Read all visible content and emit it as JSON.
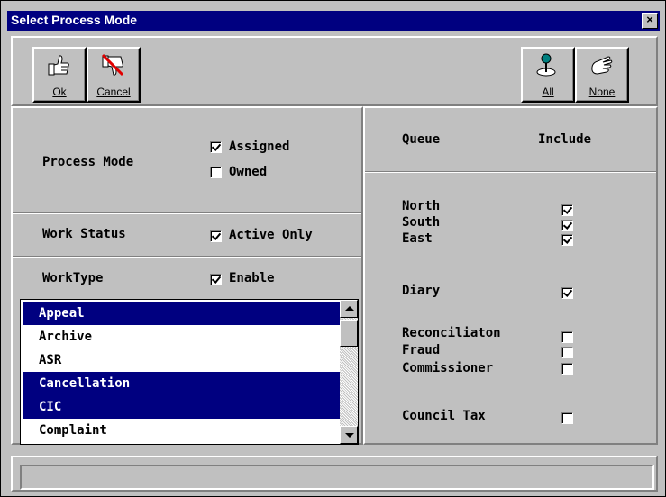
{
  "window": {
    "title": "Select Process Mode",
    "close_label": "×"
  },
  "toolbar": {
    "ok_label": "Ok",
    "cancel_label": "Cancel",
    "all_label": "All",
    "none_label": "None"
  },
  "process_mode": {
    "label": "Process Mode",
    "options": [
      {
        "label": "Assigned",
        "checked": true
      },
      {
        "label": "Owned",
        "checked": false
      }
    ]
  },
  "work_status": {
    "label": "Work Status",
    "option": {
      "label": "Active Only",
      "checked": true
    }
  },
  "work_type": {
    "label": "WorkType",
    "option": {
      "label": "Enable",
      "checked": true
    },
    "items": [
      {
        "label": "Appeal",
        "selected": true
      },
      {
        "label": "Archive",
        "selected": false
      },
      {
        "label": "ASR",
        "selected": false
      },
      {
        "label": "Cancellation",
        "selected": true
      },
      {
        "label": "CIC",
        "selected": true
      },
      {
        "label": "Complaint",
        "selected": false
      }
    ]
  },
  "queues": {
    "header_queue": "Queue",
    "header_include": "Include",
    "items": [
      {
        "label": "North",
        "checked": true
      },
      {
        "label": "South",
        "checked": true
      },
      {
        "label": "East",
        "checked": true
      },
      {
        "label": "Diary",
        "checked": true
      },
      {
        "label": "Reconciliaton",
        "checked": false
      },
      {
        "label": "Fraud",
        "checked": false
      },
      {
        "label": "Commissioner",
        "checked": false
      },
      {
        "label": "Council Tax",
        "checked": false
      }
    ]
  },
  "status": {
    "text": ""
  }
}
